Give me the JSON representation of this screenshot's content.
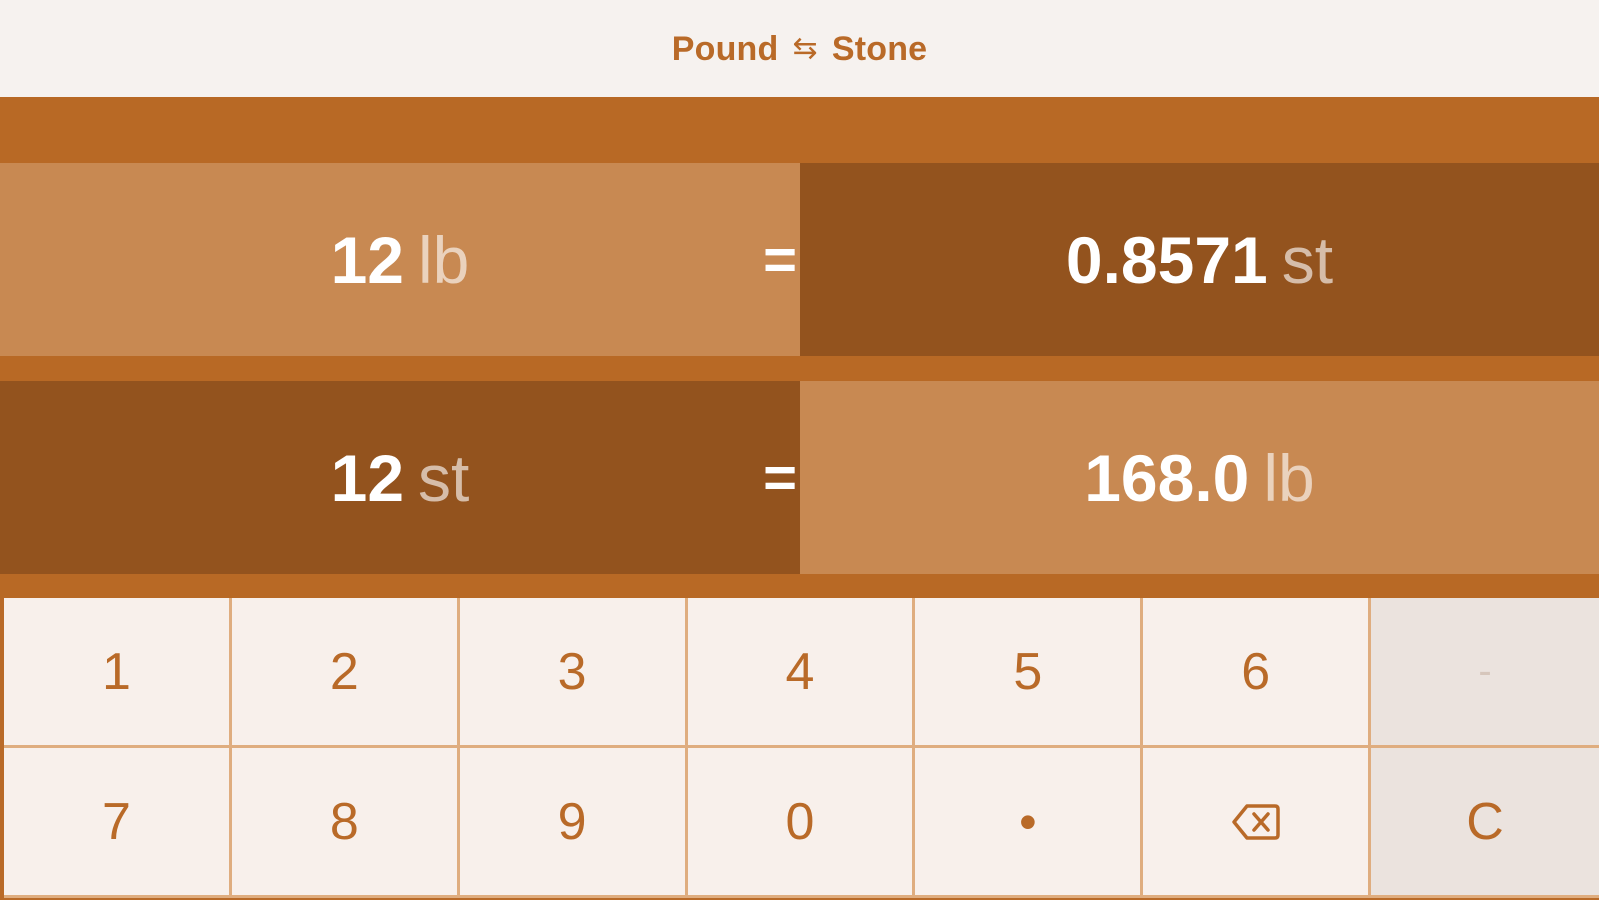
{
  "header": {
    "from_unit": "Pound",
    "swap_symbol": "⇆",
    "to_unit": "Stone"
  },
  "conversions": [
    {
      "input_value": "12",
      "input_unit": "lb",
      "equals": "=",
      "output_value": "0.8571",
      "output_unit": "st"
    },
    {
      "input_value": "12",
      "input_unit": "st",
      "equals": "=",
      "output_value": "168.0",
      "output_unit": "lb"
    }
  ],
  "keypad": {
    "row1": [
      "1",
      "2",
      "3",
      "4",
      "5",
      "6",
      "-"
    ],
    "row2": [
      "7",
      "8",
      "9",
      "0",
      "•",
      "backspace-icon",
      "C"
    ]
  },
  "colors": {
    "accent": "#b96a28",
    "light_cell": "#c88952",
    "dark_cell": "#93531e",
    "key_bg": "#f8f0eb"
  }
}
